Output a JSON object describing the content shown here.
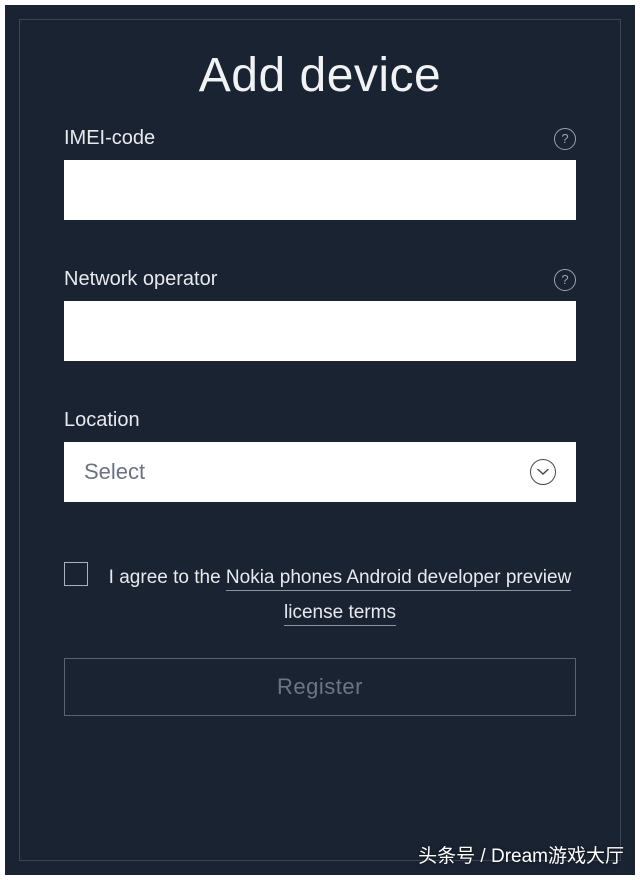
{
  "title": "Add device",
  "fields": {
    "imei": {
      "label": "IMEI-code",
      "value": ""
    },
    "network": {
      "label": "Network operator",
      "value": ""
    },
    "location": {
      "label": "Location",
      "placeholder": "Select"
    }
  },
  "agreement": {
    "prefix": "I agree to the ",
    "link": "Nokia phones Android developer preview license terms"
  },
  "register_label": "Register",
  "watermark": "头条号 / Dream游戏大厅"
}
